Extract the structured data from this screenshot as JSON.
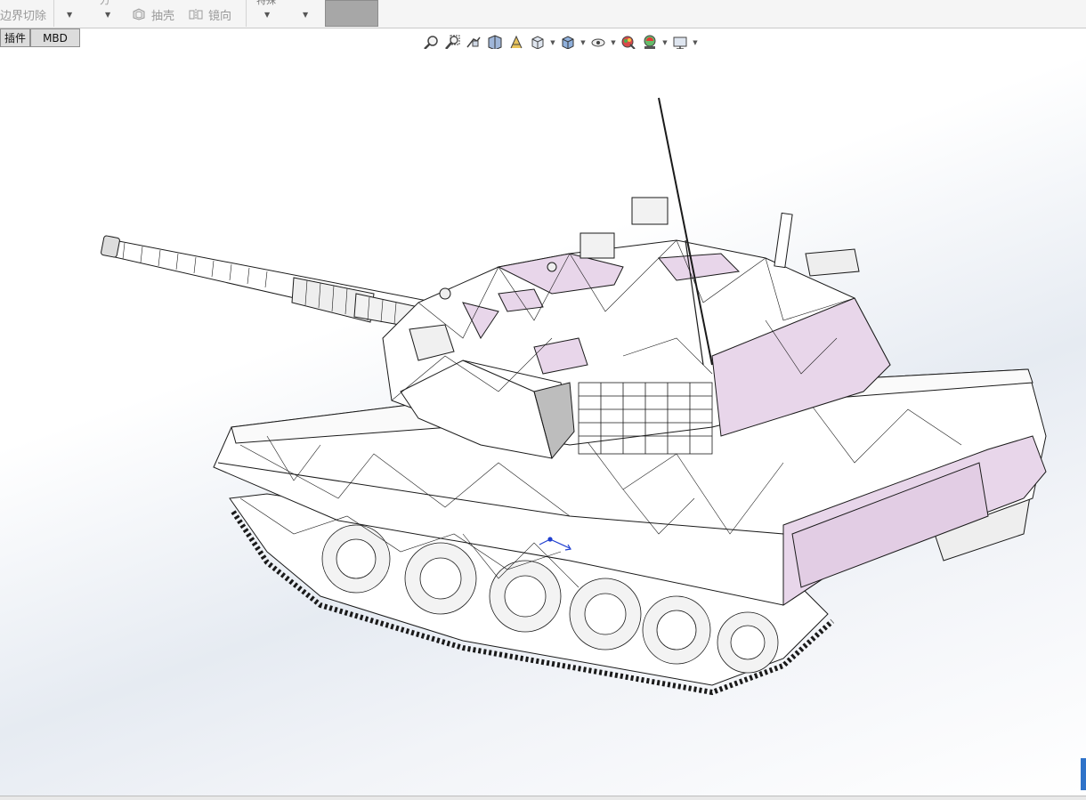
{
  "ribbon": {
    "boundary_cut_label": "边界切除",
    "shell_label": "抽壳",
    "mirror_label": "镜向",
    "truncated_label_1": "力",
    "truncated_label_2": "特殊"
  },
  "tabs": [
    {
      "label": "插件"
    },
    {
      "label": "MBD"
    }
  ],
  "heads_up_toolbar": {
    "icons": [
      "zoom-to-fit-icon",
      "zoom-to-area-icon",
      "previous-view-icon",
      "section-view-icon",
      "dynamic-annotation-icon",
      "view-orientation-icon",
      "display-style-icon",
      "hide-show-items-icon",
      "edit-appearance-icon",
      "apply-scene-icon",
      "view-settings-icon"
    ]
  },
  "viewport": {
    "model": "tank-wireframe-model",
    "background_top": "#ffffff",
    "background_mid": "#e6ebf2",
    "accent_face_color": "#e8d6ea",
    "edge_color": "#1a1a1a",
    "triad_color": "#1f3fd0"
  }
}
